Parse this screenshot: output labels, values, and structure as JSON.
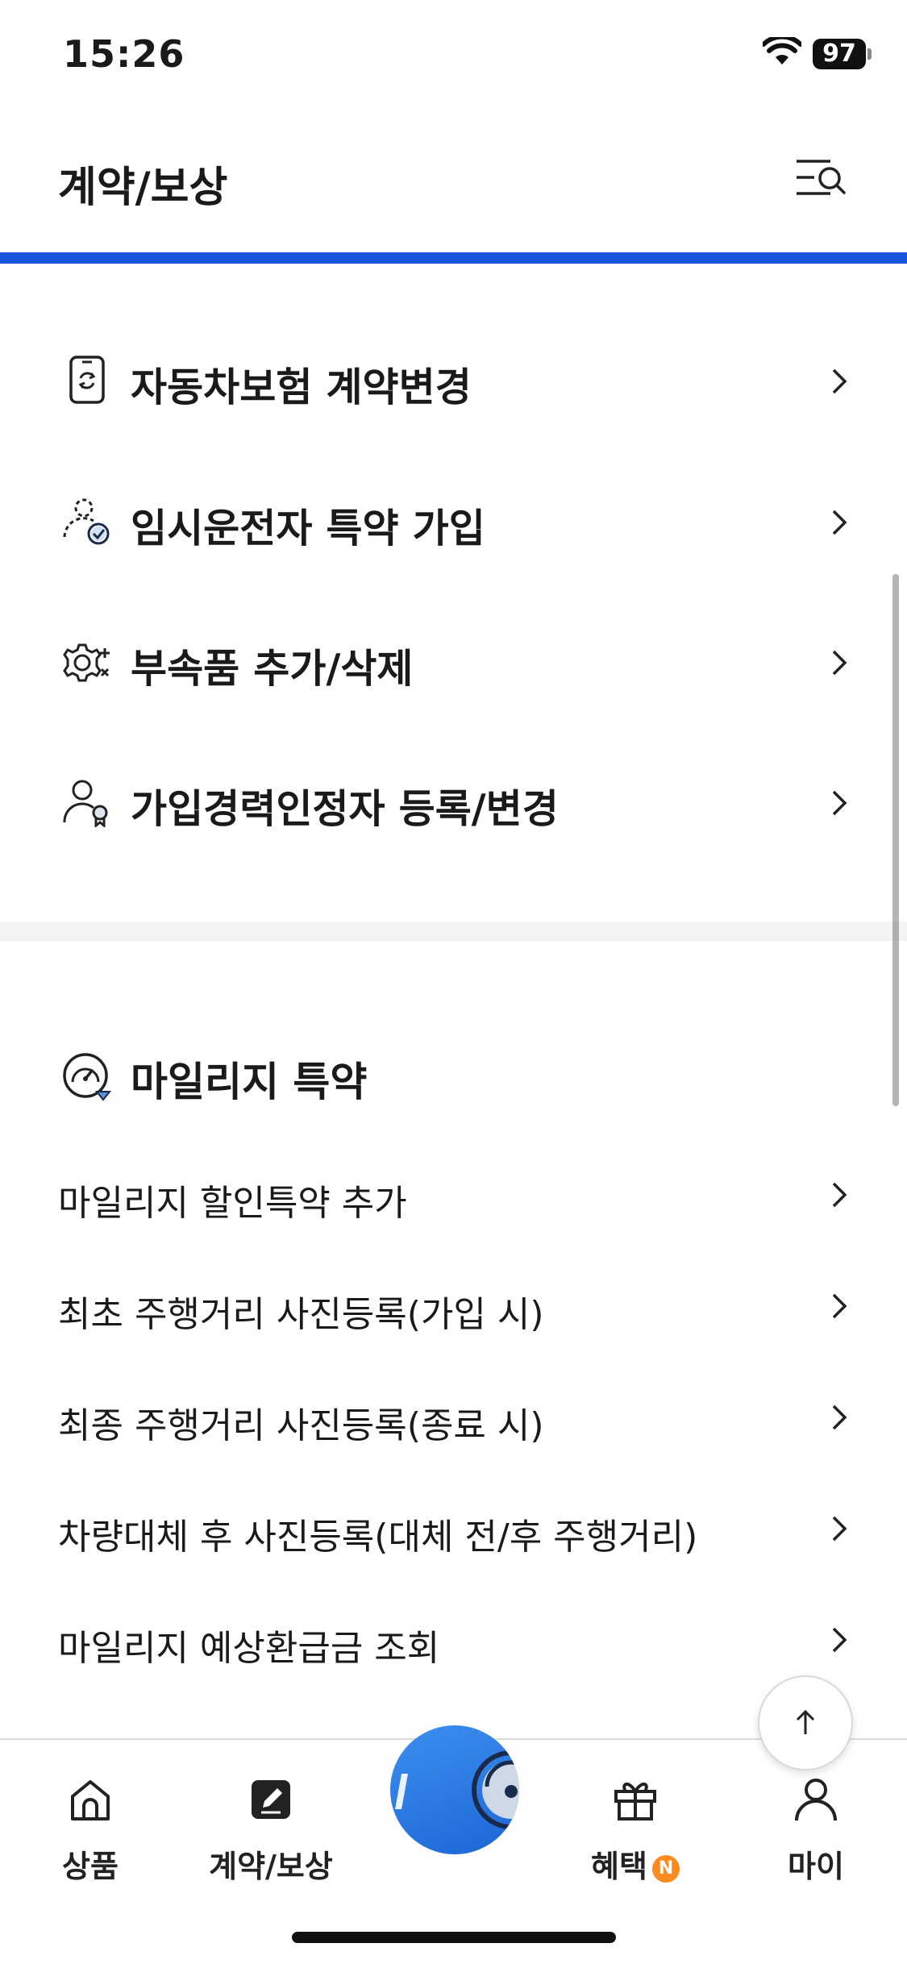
{
  "status_bar": {
    "time": "15:26",
    "battery": "97"
  },
  "header": {
    "title": "계약/보상"
  },
  "main_items": [
    {
      "label": "자동차보험 계약변경",
      "icon": "phone-refresh-icon"
    },
    {
      "label": "임시운전자 특약 가입",
      "icon": "person-check-icon"
    },
    {
      "label": "부속품 추가/삭제",
      "icon": "gear-plus-minus-icon"
    },
    {
      "label": "가입경력인정자 등록/변경",
      "icon": "person-badge-icon"
    }
  ],
  "mileage_section": {
    "title": "마일리지 특약",
    "icon": "gauge-icon",
    "items": [
      "마일리지 할인특약 추가",
      "최초 주행거리 사진등록(가입 시)",
      "최종 주행거리 사진등록(종료 시)",
      "차량대체 후 사진등록(대체 전/후 주행거리)",
      "마일리지 예상환급금 조회"
    ]
  },
  "tab_bar": {
    "tabs": [
      {
        "label": "상품",
        "icon": "home-icon"
      },
      {
        "label": "계약/보상",
        "icon": "edit-icon"
      },
      {
        "label": "혜택",
        "icon": "gift-icon",
        "badge": "N"
      },
      {
        "label": "마이",
        "icon": "person-icon"
      }
    ]
  },
  "colors": {
    "accent": "#1a56db",
    "badge": "#ff8a1e",
    "fab": "#2a78e4"
  }
}
